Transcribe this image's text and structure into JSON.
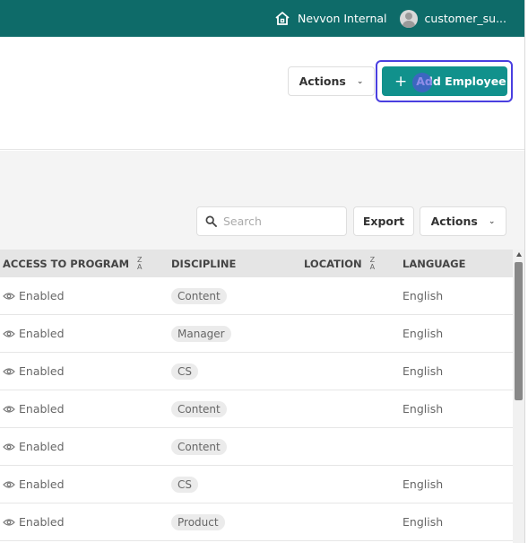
{
  "topbar": {
    "org_name": "Nevvon Internal",
    "user_name": "customer_su..."
  },
  "toolbar": {
    "actions_label": "Actions",
    "add_employee_label": "Add Employee"
  },
  "filters": {
    "search_placeholder": "Search",
    "export_label": "Export",
    "actions_label": "Actions"
  },
  "table": {
    "headers": {
      "access": "ACCESS TO PROGRAM",
      "discipline": "DISCIPLINE",
      "location": "LOCATION",
      "language": "LANGUAGE"
    },
    "rows": [
      {
        "access": "Enabled",
        "discipline": "Content",
        "location": "",
        "language": "English"
      },
      {
        "access": "Enabled",
        "discipline": "Manager",
        "location": "",
        "language": "English"
      },
      {
        "access": "Enabled",
        "discipline": "CS",
        "location": "",
        "language": "English"
      },
      {
        "access": "Enabled",
        "discipline": "Content",
        "location": "",
        "language": "English"
      },
      {
        "access": "Enabled",
        "discipline": "Content",
        "location": "",
        "language": ""
      },
      {
        "access": "Enabled",
        "discipline": "CS",
        "location": "",
        "language": "English"
      },
      {
        "access": "Enabled",
        "discipline": "Product",
        "location": "",
        "language": "English"
      }
    ]
  },
  "colors": {
    "topbar": "#0e6b69",
    "primary_button": "#11918c",
    "focus_ring": "#4a3fe0"
  }
}
